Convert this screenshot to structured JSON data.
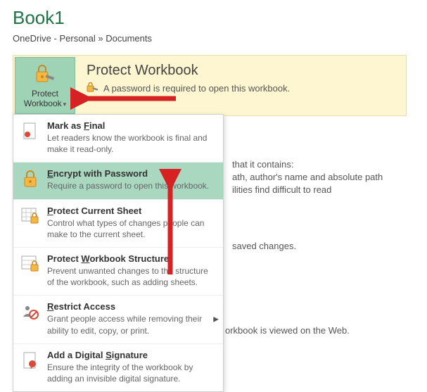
{
  "title": "Book1",
  "breadcrumb": "OneDrive - Personal » Documents",
  "protectButton": {
    "label": "Protect Workbook"
  },
  "banner": {
    "title": "Protect Workbook",
    "desc": "A password is required to open this workbook."
  },
  "menu": [
    {
      "label": "Mark as Final",
      "mn": "F",
      "desc": "Let readers know the workbook is final and make it read-only."
    },
    {
      "label": "Encrypt with Password",
      "mn": "E",
      "desc": "Require a password to open this workbook."
    },
    {
      "label": "Protect Current Sheet",
      "mn": "P",
      "desc": "Control what types of changes people can make to the current sheet."
    },
    {
      "label": "Protect Workbook Structure",
      "mn": "W",
      "desc": "Prevent unwanted changes to the structure of the workbook, such as adding sheets."
    },
    {
      "label": "Restrict Access",
      "mn": "R",
      "desc": "Grant people access while removing their ability to edit, copy, or print."
    },
    {
      "label": "Add a Digital Signature",
      "mn": "S",
      "desc": "Ensure the integrity of the workbook by adding an invisible digital signature."
    }
  ],
  "bg": {
    "line1": "that it contains:",
    "line2": "ath, author's name and absolute path",
    "line3": "ilities find difficult to read",
    "line4": "saved changes.",
    "line5": "orkbook is viewed on the Web."
  }
}
